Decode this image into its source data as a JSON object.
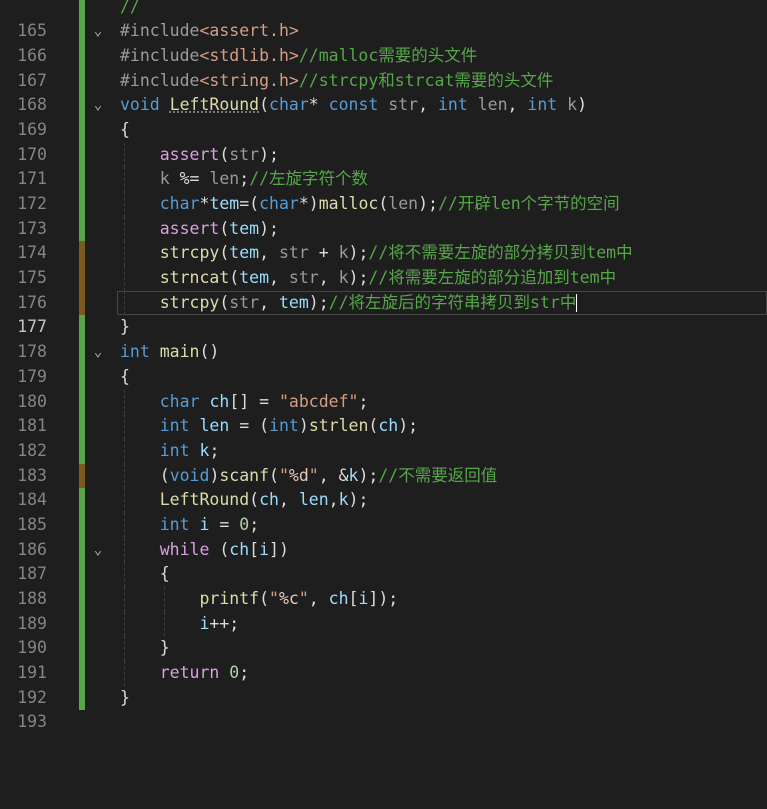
{
  "editor": {
    "active_line": "177",
    "lines": [
      {
        "num": "165",
        "fold": "",
        "code": "//"
      },
      {
        "num": "166",
        "fold": "⌄",
        "code": "#include<assert.h>"
      },
      {
        "num": "167",
        "fold": "",
        "code": "#include<stdlib.h>//malloc需要的头文件"
      },
      {
        "num": "168",
        "fold": "",
        "code": "#include<string.h>//strcpy和strcat需要的头文件"
      },
      {
        "num": "169",
        "fold": "⌄",
        "code": "void LeftRound(char* const str, int len, int k)"
      },
      {
        "num": "170",
        "fold": "",
        "code": "{"
      },
      {
        "num": "171",
        "fold": "",
        "code": "    assert(str);"
      },
      {
        "num": "172",
        "fold": "",
        "code": "    k %= len;//左旋字符个数"
      },
      {
        "num": "173",
        "fold": "",
        "code": "    char*tem=(char*)malloc(len);//开辟len个字节的空间"
      },
      {
        "num": "174",
        "fold": "",
        "code": "    assert(tem);"
      },
      {
        "num": "175",
        "fold": "",
        "code": "    strcpy(tem, str + k);//将不需要左旋的部分拷贝到tem中"
      },
      {
        "num": "176",
        "fold": "",
        "code": "    strncat(tem, str, k);//将需要左旋的部分追加到tem中"
      },
      {
        "num": "177",
        "fold": "",
        "code": "    strcpy(str, tem);//将左旋后的字符串拷贝到str中"
      },
      {
        "num": "178",
        "fold": "",
        "code": "}"
      },
      {
        "num": "179",
        "fold": "⌄",
        "code": "int main()"
      },
      {
        "num": "180",
        "fold": "",
        "code": "{"
      },
      {
        "num": "181",
        "fold": "",
        "code": "    char ch[] = \"abcdef\";"
      },
      {
        "num": "182",
        "fold": "",
        "code": "    int len = (int)strlen(ch);"
      },
      {
        "num": "183",
        "fold": "",
        "code": "    int k;"
      },
      {
        "num": "184",
        "fold": "",
        "code": "    (void)scanf(\"%d\", &k);//不需要返回值"
      },
      {
        "num": "185",
        "fold": "",
        "code": "    LeftRound(ch, len,k);"
      },
      {
        "num": "186",
        "fold": "",
        "code": "    int i = 0;"
      },
      {
        "num": "187",
        "fold": "⌄",
        "code": "    while (ch[i])"
      },
      {
        "num": "188",
        "fold": "",
        "code": "    {"
      },
      {
        "num": "189",
        "fold": "",
        "code": "        printf(\"%c\", ch[i]);"
      },
      {
        "num": "190",
        "fold": "",
        "code": "        i++;"
      },
      {
        "num": "191",
        "fold": "",
        "code": "    }"
      },
      {
        "num": "192",
        "fold": "",
        "code": "    return 0;"
      },
      {
        "num": "193",
        "fold": "",
        "code": "}"
      }
    ]
  },
  "colors": {
    "background": "#1e1e1e",
    "saved_change_bar": "#57a64a",
    "unsaved_change_bar": "#7a5a1f",
    "keyword": "#569cd6",
    "control_keyword": "#d8a0df",
    "function": "#dcdcaa",
    "string": "#d69d85",
    "comment": "#57a64a",
    "number": "#b5cea8",
    "variable": "#9cdcfe"
  },
  "icons": {
    "fold": "chevron-down-icon"
  }
}
